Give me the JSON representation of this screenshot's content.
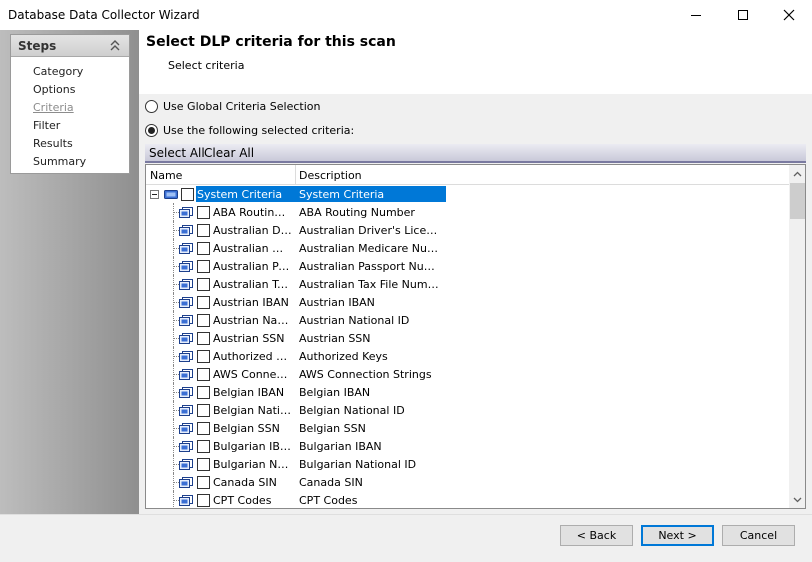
{
  "window": {
    "title": "Database Data Collector Wizard"
  },
  "steps": {
    "header": "Steps",
    "items": [
      {
        "label": "Category",
        "active": false
      },
      {
        "label": "Options",
        "active": false
      },
      {
        "label": "Criteria",
        "active": true
      },
      {
        "label": "Filter",
        "active": false
      },
      {
        "label": "Results",
        "active": false
      },
      {
        "label": "Summary",
        "active": false
      }
    ]
  },
  "page": {
    "title": "Select DLP criteria for this scan",
    "subtitle": "Select criteria"
  },
  "criteria_mode": {
    "global_label": "Use Global Criteria Selection",
    "selected_label": "Use the following selected criteria:",
    "selected_option": "selected"
  },
  "selection_bar": {
    "select_all": "Select All",
    "clear_all": "Clear All"
  },
  "grid": {
    "columns": [
      "Name",
      "Description"
    ],
    "root": {
      "name": "System Criteria",
      "description": "System Criteria"
    },
    "rows": [
      {
        "name": "ABA Routing Number",
        "description": "ABA Routing Number"
      },
      {
        "name": "Australian Driver's License",
        "description": "Australian Driver's License"
      },
      {
        "name": "Australian Medicare Number",
        "description": "Australian Medicare Number"
      },
      {
        "name": "Australian Passport Number",
        "description": "Australian Passport Number"
      },
      {
        "name": "Australian Tax File Number",
        "description": "Australian Tax File Number (TFN)"
      },
      {
        "name": "Austrian IBAN",
        "description": "Austrian IBAN"
      },
      {
        "name": "Austrian National ID",
        "description": "Austrian National ID"
      },
      {
        "name": "Austrian SSN",
        "description": "Austrian SSN"
      },
      {
        "name": "Authorized Keys",
        "description": "Authorized Keys"
      },
      {
        "name": "AWS Connection Strings",
        "description": "AWS Connection Strings"
      },
      {
        "name": "Belgian IBAN",
        "description": "Belgian IBAN"
      },
      {
        "name": "Belgian National ID",
        "description": "Belgian National ID"
      },
      {
        "name": "Belgian SSN",
        "description": "Belgian SSN"
      },
      {
        "name": "Bulgarian IBAN",
        "description": "Bulgarian IBAN"
      },
      {
        "name": "Bulgarian National ID",
        "description": "Bulgarian National ID"
      },
      {
        "name": "Canada SIN",
        "description": "Canada SIN"
      },
      {
        "name": "CPT Codes",
        "description": "CPT Codes"
      }
    ]
  },
  "footer": {
    "back": "< Back",
    "next": "Next >",
    "cancel": "Cancel"
  }
}
